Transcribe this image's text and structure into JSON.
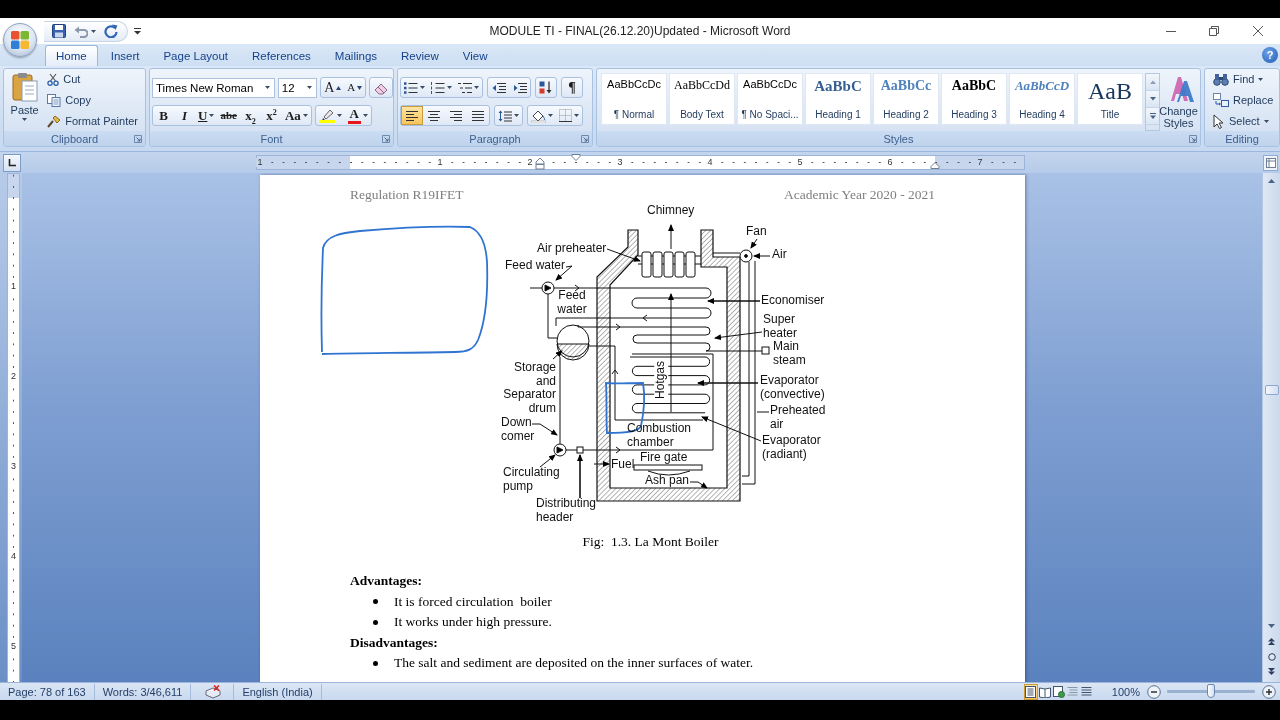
{
  "window": {
    "title": "MODULE TI - FINAL(26.12.20)Updated - Microsoft Word"
  },
  "ribbon_tabs": [
    {
      "label": "Home",
      "selected": true
    },
    {
      "label": "Insert",
      "selected": false
    },
    {
      "label": "Page Layout",
      "selected": false
    },
    {
      "label": "References",
      "selected": false
    },
    {
      "label": "Mailings",
      "selected": false
    },
    {
      "label": "Review",
      "selected": false
    },
    {
      "label": "View",
      "selected": false
    }
  ],
  "help_button": "?",
  "clipboard": {
    "label": "Clipboard",
    "paste": "Paste",
    "actions": [
      {
        "kind": "cut",
        "label": "Cut"
      },
      {
        "kind": "copy",
        "label": "Copy"
      },
      {
        "kind": "format_painter",
        "label": "Format Painter"
      }
    ]
  },
  "font": {
    "label": "Font",
    "font_name": "Times New Roman",
    "font_size": "12",
    "size_buttons": [
      {
        "kind": "grow",
        "glyph": "A"
      },
      {
        "kind": "shrink",
        "glyph": "A"
      }
    ],
    "format_buttons": [
      {
        "kind": "bold",
        "glyph": "B"
      },
      {
        "kind": "italic",
        "glyph": "I"
      },
      {
        "kind": "underline",
        "glyph": "U"
      },
      {
        "kind": "strikethrough",
        "glyph": "abe"
      },
      {
        "kind": "subscript",
        "glyph": "x$_{2}$"
      },
      {
        "kind": "superscript",
        "glyph": "x$^{2}$"
      },
      {
        "kind": "change_case",
        "glyph": "Aa"
      }
    ],
    "font_color_glyph": "A"
  },
  "paragraph": {
    "label": "Paragraph",
    "show_marks": "¶",
    "alignment": [
      {
        "kind": "left",
        "selected": true
      },
      {
        "kind": "center",
        "selected": false
      },
      {
        "kind": "right",
        "selected": false
      },
      {
        "kind": "justify",
        "selected": false
      }
    ]
  },
  "styles": {
    "label": "Styles",
    "gallery": [
      {
        "kind": "normal",
        "preview": "AaBbCcDc",
        "name": "¶ Normal",
        "selected": false
      },
      {
        "kind": "body_text",
        "preview": "AaBbCcDd",
        "name": "Body Text",
        "selected": false
      },
      {
        "kind": "no_spacing",
        "preview": "AaBbCcDc",
        "name": "¶ No Spaci...",
        "selected": false
      },
      {
        "kind": "heading_1",
        "preview": "AaBbC",
        "name": "Heading 1",
        "selected": false
      },
      {
        "kind": "heading_2",
        "preview": "AaBbCc",
        "name": "Heading 2",
        "selected": false
      },
      {
        "kind": "heading_3",
        "preview": "AaBbC",
        "name": "Heading 3",
        "selected": false
      },
      {
        "kind": "heading_4",
        "preview": "AaBbCcD",
        "name": "Heading 4",
        "selected": false
      },
      {
        "kind": "title",
        "preview": "AaB",
        "name": "Title",
        "selected": false
      }
    ],
    "change_styles": "Change Styles"
  },
  "editing": {
    "label": "Editing",
    "actions": [
      {
        "kind": "find",
        "label": "Find"
      },
      {
        "kind": "replace",
        "label": "Replace"
      },
      {
        "kind": "select",
        "label": "Select"
      }
    ]
  },
  "rulers": {
    "horizontal": [
      "1",
      "1",
      "2",
      "3",
      "4",
      "5",
      "6",
      "7"
    ],
    "vertical": [
      "1",
      "2",
      "3",
      "4",
      "5"
    ]
  },
  "page": {
    "header_left": "Regulation R19IFET",
    "header_right": "Academic Year 2020 - 2021",
    "figure": {
      "labels": [
        {
          "kind": "single",
          "text": "Chimney"
        },
        {
          "kind": "single",
          "text": "Fan"
        },
        {
          "kind": "single",
          "text": "Air preheater"
        },
        {
          "kind": "single",
          "text": "Air"
        },
        {
          "kind": "single",
          "text": "Feed water"
        },
        {
          "kind": "stacked",
          "text": "Feed water"
        },
        {
          "kind": "single",
          "text": "Economiser"
        },
        {
          "kind": "stacked",
          "text": "Super heater"
        },
        {
          "kind": "stacked",
          "text": "Main steam"
        },
        {
          "kind": "stacked",
          "text": "Storage and Separator drum"
        },
        {
          "kind": "vertical",
          "text": "Hotgas"
        },
        {
          "kind": "stacked",
          "text": "Evaporator (convective)"
        },
        {
          "kind": "stacked",
          "text": "Down comer"
        },
        {
          "kind": "stacked",
          "text": "Combustion chamber"
        },
        {
          "kind": "stacked",
          "text": "Preheated air"
        },
        {
          "kind": "single",
          "text": "Fuel"
        },
        {
          "kind": "single",
          "text": "Fire gate"
        },
        {
          "kind": "stacked",
          "text": "Evaporator (radiant)"
        },
        {
          "kind": "stacked",
          "text": "Circulating pump"
        },
        {
          "kind": "single",
          "text": "Ash pan"
        },
        {
          "kind": "stacked",
          "text": "Distributing header"
        }
      ],
      "caption": "Fig:  1.3. La Mont Boiler"
    },
    "sections": [
      {
        "heading": "Advantages:",
        "bullets": [
          "It is forced circulation  boiler",
          "It works under high pressure."
        ]
      },
      {
        "heading": "Disadvantages:",
        "bullets": [
          "The salt and sediment are deposited on the inner surfaces of water."
        ]
      }
    ]
  },
  "status_bar": {
    "page": "Page: 78 of 163",
    "words": "Words: 3/46,611",
    "language": "English (India)",
    "views": [
      {
        "kind": "print_layout",
        "selected": true
      },
      {
        "kind": "full_screen_reading",
        "selected": false
      },
      {
        "kind": "web_layout",
        "selected": false
      },
      {
        "kind": "outline",
        "selected": false
      },
      {
        "kind": "draft",
        "selected": false
      }
    ],
    "zoom": "100%",
    "zoom_slider": {
      "level": 0.5
    }
  }
}
